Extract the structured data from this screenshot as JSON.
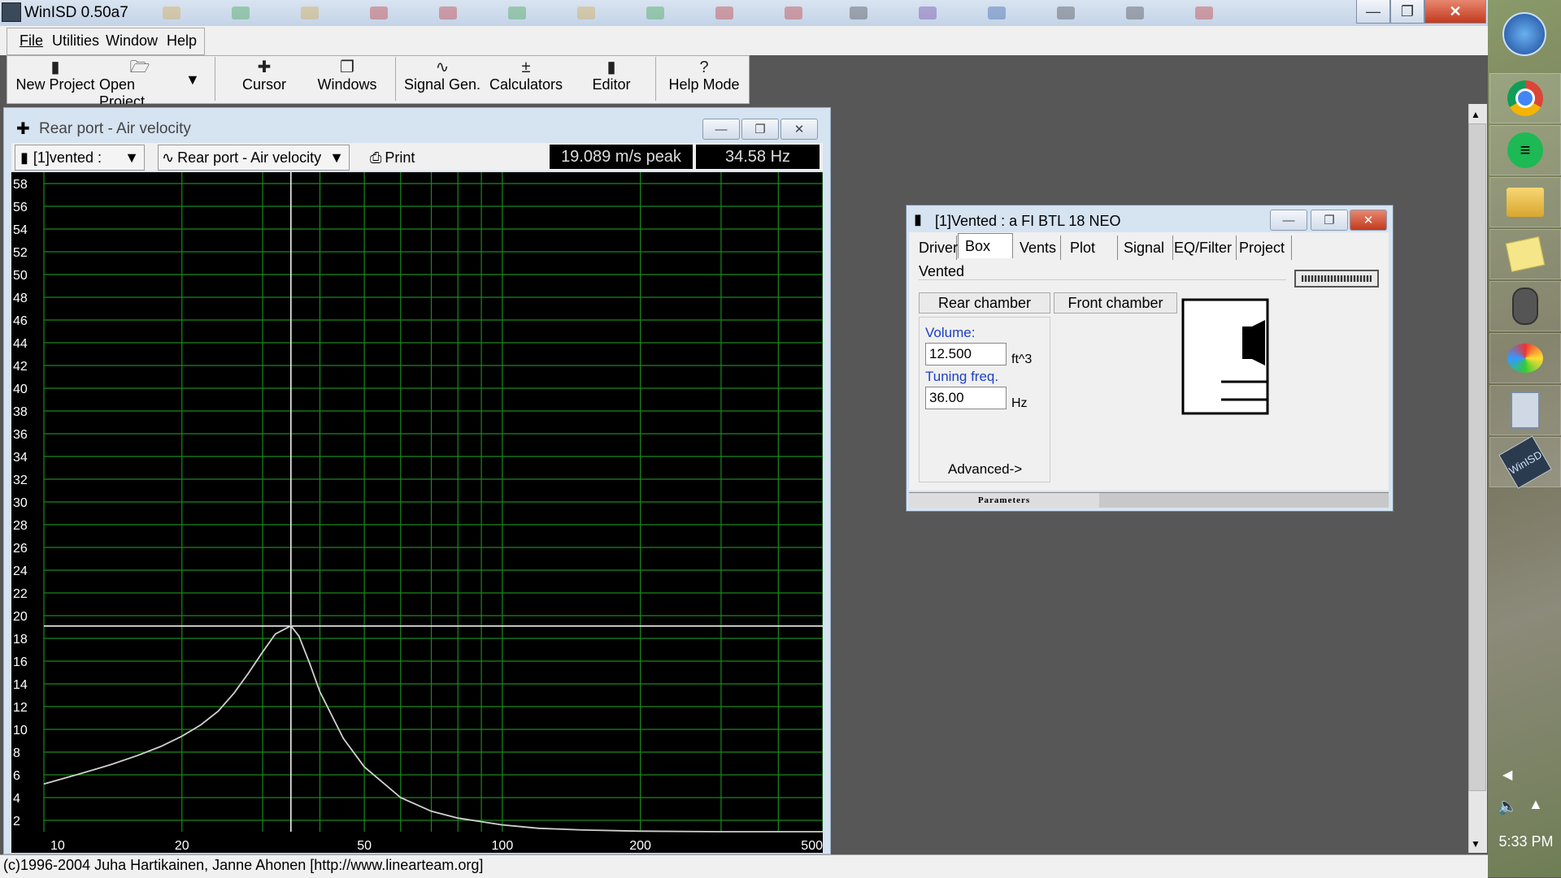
{
  "app": {
    "title": "WinISD 0.50a7"
  },
  "menu": [
    "File",
    "Utilities",
    "Window",
    "Help"
  ],
  "toolbar": {
    "new_project": "New Project",
    "open_project": "Open Project",
    "cursor": "Cursor",
    "windows": "Windows",
    "signal_gen": "Signal Gen.",
    "calculators": "Calculators",
    "editor": "Editor",
    "help_mode": "Help Mode"
  },
  "chart_window": {
    "title": "Rear port - Air velocity",
    "project_select": "[1]vented :",
    "graph_select": "Rear port - Air velocity",
    "print_label": "Print",
    "peak_readout": "19.089 m/s peak",
    "freq_readout": "34.58 Hz"
  },
  "chart_data": {
    "type": "line",
    "title": "",
    "xlabel": "",
    "ylabel": "",
    "x_scale": "log",
    "xlim": [
      10,
      500
    ],
    "ylim": [
      1,
      59
    ],
    "x_ticks": [
      10,
      20,
      50,
      100,
      200,
      500
    ],
    "y_ticks": [
      2,
      4,
      6,
      8,
      10,
      12,
      14,
      16,
      18,
      20,
      22,
      24,
      26,
      28,
      30,
      32,
      34,
      36,
      38,
      40,
      42,
      44,
      46,
      48,
      50,
      52,
      54,
      56,
      58
    ],
    "grid": true,
    "colors": {
      "background": "#000000",
      "grid": "#1a8a1a",
      "line": "#d0d0d0",
      "cursor": "#ffffff"
    },
    "cursor": {
      "x": 34.58,
      "y": 19.089
    },
    "series": [
      {
        "x": [
          10,
          12,
          14,
          16,
          18,
          20,
          22,
          24,
          26,
          28,
          30,
          32,
          34.58,
          36,
          38,
          40,
          45,
          50,
          60,
          70,
          80,
          100,
          120,
          150,
          200,
          300,
          400,
          500
        ],
        "y": [
          5.2,
          6.1,
          6.9,
          7.7,
          8.5,
          9.4,
          10.4,
          11.6,
          13.2,
          15.0,
          16.8,
          18.4,
          19.1,
          18.2,
          15.8,
          13.3,
          9.2,
          6.7,
          4.0,
          2.8,
          2.2,
          1.6,
          1.3,
          1.15,
          1.05,
          1.0,
          1.0,
          1.0
        ]
      }
    ]
  },
  "vented_window": {
    "title": "[1]Vented : a FI BTL 18 NEO",
    "tabs": [
      "Driver",
      "Box",
      "Vents",
      "Plot",
      "Signal",
      "EQ/Filter",
      "Project"
    ],
    "box_type": "Vented",
    "rear_chamber": "Rear chamber",
    "front_chamber": "Front chamber",
    "volume_label": "Volume:",
    "volume_value": "12.500",
    "volume_unit": "ft^3",
    "tuning_label": "Tuning freq.",
    "tuning_value": "36.00",
    "tuning_unit": "Hz",
    "advanced": "Advanced->",
    "status": "Parameters"
  },
  "status_bar": "(c)1996-2004 Juha Hartikainen, Janne Ahonen [http://www.linearteam.org]",
  "taskbar": {
    "time": "5:33 PM"
  }
}
